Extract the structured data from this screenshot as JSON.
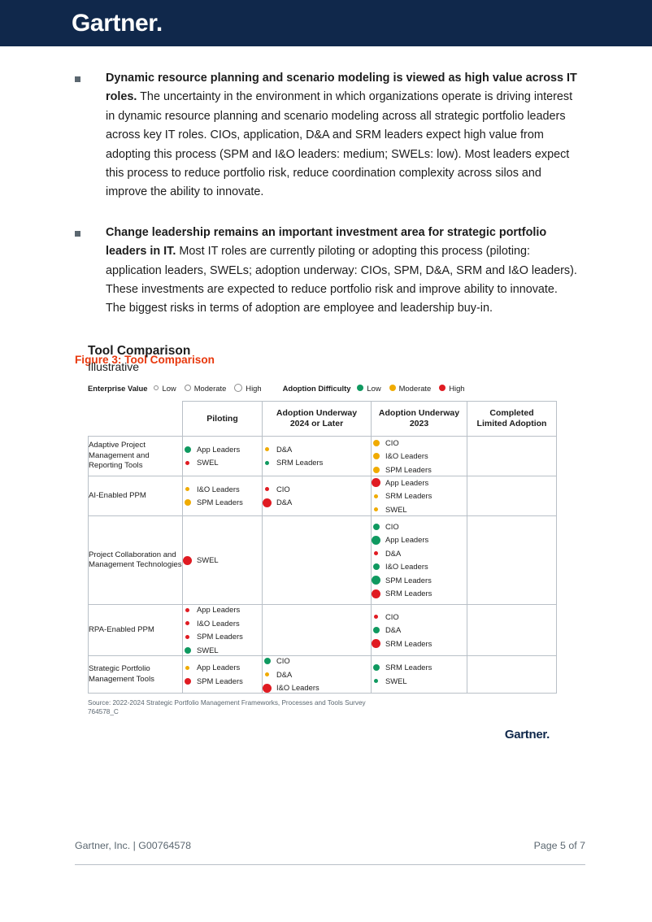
{
  "header": {
    "brand": "Gartner",
    "brand_dot": "."
  },
  "bullets": [
    {
      "lead": "Dynamic resource planning and scenario modeling is viewed as high value across IT roles.",
      "rest": " The uncertainty in the environment in which organizations operate is driving interest in dynamic resource planning and scenario modeling across all strategic portfolio leaders across key IT roles. CIOs, application, D&A and SRM leaders expect high value from adopting this process (SPM and I&O leaders: medium; SWELs: low). Most leaders expect this process to reduce portfolio risk, reduce coordination complexity across silos and improve the ability to innovate."
    },
    {
      "lead": "Change leadership remains an important investment area for strategic portfolio leaders in IT.",
      "rest": " Most IT roles are currently piloting or adopting this process (piloting: application leaders, SWELs; adoption underway: CIOs, SPM, D&A, SRM and I&O leaders). These investments are expected to reduce portfolio risk and improve ability to innovate. The biggest risks in terms of adoption are employee and leadership buy-in."
    }
  ],
  "figure_caption": "Figure 3: Tool Comparison",
  "figure": {
    "title": "Tool Comparison",
    "subtitle": "Illustrative",
    "legend": {
      "enterprise_value": {
        "label": "Enterprise Value",
        "items": [
          {
            "label": "Low",
            "size": "sm",
            "style": "ring"
          },
          {
            "label": "Moderate",
            "size": "md",
            "style": "ring"
          },
          {
            "label": "High",
            "size": "lg",
            "style": "ring"
          }
        ]
      },
      "adoption_difficulty": {
        "label": "Adoption Difficulty",
        "items": [
          {
            "label": "Low",
            "size": "md",
            "style": "fill",
            "color": "#0f9960"
          },
          {
            "label": "Moderate",
            "size": "md",
            "style": "fill",
            "color": "#f0ab00"
          },
          {
            "label": "High",
            "size": "md",
            "style": "fill",
            "color": "#e01b22"
          }
        ]
      }
    },
    "columns": [
      "",
      "Piloting",
      "Adoption Underway 2024 or Later",
      "Adoption Underway 2023",
      "Completed Limited Adoption"
    ],
    "columns_display": [
      "",
      "Piloting",
      "Adoption Underway\n2024 or Later",
      "Adoption Underway\n2023",
      "Completed\nLimited Adoption"
    ],
    "rows": [
      {
        "label": "Adaptive Project Management and Reporting Tools",
        "piloting": [
          {
            "text": "App Leaders",
            "color": "#0f9960",
            "size": "md"
          },
          {
            "text": "SWEL",
            "color": "#e01b22",
            "size": "sm"
          }
        ],
        "underway_2024": [
          {
            "text": "D&A",
            "color": "#f0ab00",
            "size": "sm"
          },
          {
            "text": "SRM Leaders",
            "color": "#0f9960",
            "size": "sm"
          }
        ],
        "underway_2023": [
          {
            "text": "CIO",
            "color": "#f0ab00",
            "size": "md"
          },
          {
            "text": "I&O Leaders",
            "color": "#f0ab00",
            "size": "md"
          },
          {
            "text": "SPM Leaders",
            "color": "#f0ab00",
            "size": "md"
          }
        ],
        "completed": []
      },
      {
        "label": "AI-Enabled PPM",
        "piloting": [
          {
            "text": "I&O Leaders",
            "color": "#f0ab00",
            "size": "sm"
          },
          {
            "text": "SPM Leaders",
            "color": "#f0ab00",
            "size": "md"
          }
        ],
        "underway_2024": [
          {
            "text": "CIO",
            "color": "#e01b22",
            "size": "sm"
          },
          {
            "text": "D&A",
            "color": "#e01b22",
            "size": "lg"
          }
        ],
        "underway_2023": [
          {
            "text": "App Leaders",
            "color": "#e01b22",
            "size": "lg"
          },
          {
            "text": "SRM Leaders",
            "color": "#f0ab00",
            "size": "sm"
          },
          {
            "text": "SWEL",
            "color": "#f0ab00",
            "size": "sm"
          }
        ],
        "completed": []
      },
      {
        "label": "Project Collaboration and Management Technologies",
        "piloting": [
          {
            "text": "SWEL",
            "color": "#e01b22",
            "size": "lg"
          }
        ],
        "underway_2024": [],
        "underway_2023": [
          {
            "text": "CIO",
            "color": "#0f9960",
            "size": "md"
          },
          {
            "text": "App Leaders",
            "color": "#0f9960",
            "size": "lg"
          },
          {
            "text": "D&A",
            "color": "#e01b22",
            "size": "sm"
          },
          {
            "text": "I&O Leaders",
            "color": "#0f9960",
            "size": "md"
          },
          {
            "text": "SPM Leaders",
            "color": "#0f9960",
            "size": "lg"
          },
          {
            "text": "SRM Leaders",
            "color": "#e01b22",
            "size": "lg"
          }
        ],
        "completed": []
      },
      {
        "label": "RPA-Enabled PPM",
        "piloting": [
          {
            "text": "App Leaders",
            "color": "#e01b22",
            "size": "sm"
          },
          {
            "text": "I&O Leaders",
            "color": "#e01b22",
            "size": "sm"
          },
          {
            "text": "SPM Leaders",
            "color": "#e01b22",
            "size": "sm"
          },
          {
            "text": "SWEL",
            "color": "#0f9960",
            "size": "md"
          }
        ],
        "underway_2024": [],
        "underway_2023": [
          {
            "text": "CIO",
            "color": "#e01b22",
            "size": "sm"
          },
          {
            "text": "D&A",
            "color": "#0f9960",
            "size": "md"
          },
          {
            "text": "SRM Leaders",
            "color": "#e01b22",
            "size": "lg"
          }
        ],
        "completed": []
      },
      {
        "label": "Strategic Portfolio Management Tools",
        "piloting": [
          {
            "text": "App Leaders",
            "color": "#f0ab00",
            "size": "sm"
          },
          {
            "text": "SPM Leaders",
            "color": "#e01b22",
            "size": "md"
          }
        ],
        "underway_2024": [
          {
            "text": "CIO",
            "color": "#0f9960",
            "size": "md"
          },
          {
            "text": "D&A",
            "color": "#f0ab00",
            "size": "sm"
          },
          {
            "text": "I&O Leaders",
            "color": "#e01b22",
            "size": "lg"
          }
        ],
        "underway_2023": [
          {
            "text": "SRM Leaders",
            "color": "#0f9960",
            "size": "md"
          },
          {
            "text": "SWEL",
            "color": "#0f9960",
            "size": "sm"
          }
        ],
        "completed": []
      }
    ],
    "source": "Source: 2022-2024 Strategic Portfolio Management Frameworks, Processes and Tools Survey",
    "source_code": "764578_C",
    "brand": "Gartner"
  },
  "footer": {
    "left": "Gartner, Inc. | G00764578",
    "right": "Page 5 of 7"
  },
  "colors": {
    "navy": "#10284b",
    "orange": "#e8380d",
    "green": "#0f9960",
    "yellow": "#f0ab00",
    "red": "#e01b22",
    "gray": "#5b6770"
  }
}
